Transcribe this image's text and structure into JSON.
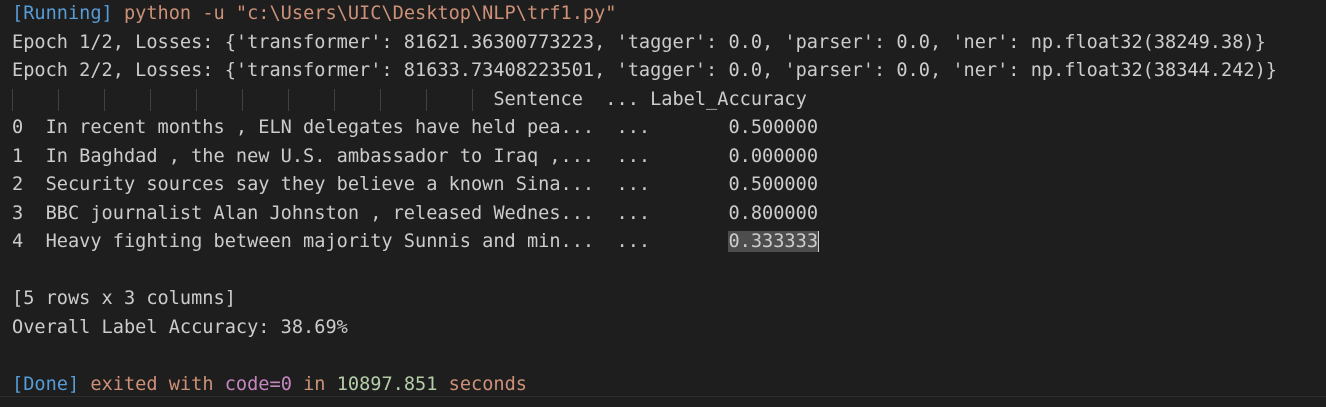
{
  "header": {
    "status": "[Running]",
    "command": "python -u \"c:\\Users\\UIC\\Desktop\\NLP\\trf1.py\""
  },
  "epochs": [
    "Epoch 1/2, Losses: {'transformer': 81621.36300773223, 'tagger': 0.0, 'parser': 0.0, 'ner': np.float32(38249.38)}",
    "Epoch 2/2, Losses: {'transformer': 81633.73408223501, 'tagger': 0.0, 'parser': 0.0, 'ner': np.float32(38344.242)}"
  ],
  "table": {
    "header": "                                           Sentence  ... Label_Accuracy",
    "rows": [
      {
        "text": "0  In recent months , ELN delegates have held pea...  ...       ",
        "value": "0.500000"
      },
      {
        "text": "1  In Baghdad , the new U.S. ambassador to Iraq ,...  ...       ",
        "value": "0.000000"
      },
      {
        "text": "2  Security sources say they believe a known Sina...  ...       ",
        "value": "0.500000"
      },
      {
        "text": "3  BBC journalist Alan Johnston , released Wednes...  ...       ",
        "value": "0.800000"
      },
      {
        "text": "4  Heavy fighting between majority Sunnis and min...  ...       ",
        "value": "0.333333"
      }
    ],
    "summary": "[5 rows x 3 columns]"
  },
  "overall": "Overall Label Accuracy: 38.69%",
  "footer": {
    "status": "[Done]",
    "exited_with": "exited with",
    "code": "code=0",
    "in_word": "in",
    "seconds_value": "10897.851",
    "seconds_word": "seconds"
  }
}
